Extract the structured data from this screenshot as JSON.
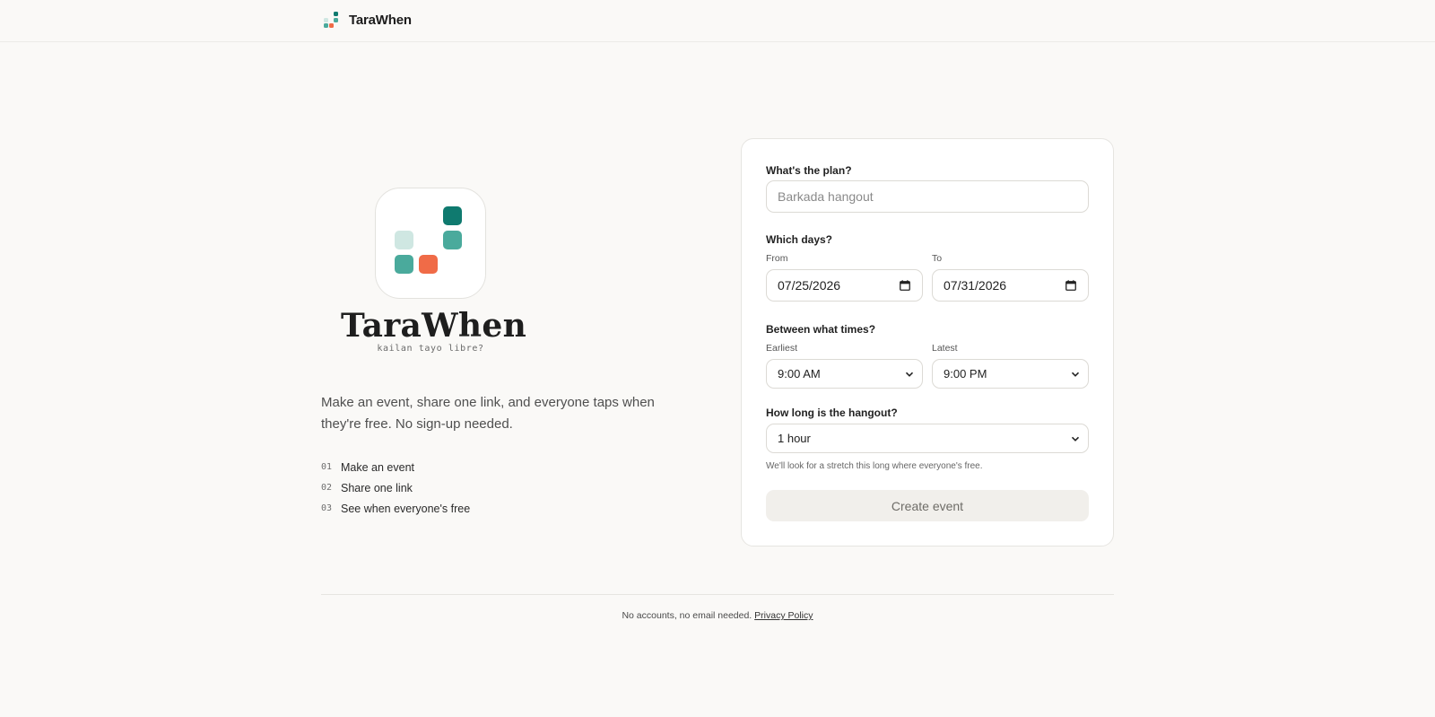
{
  "header": {
    "brand_name": "TaraWhen"
  },
  "hero": {
    "title": "TaraWhen",
    "tagline": "kailan tayo libre?",
    "description": "Make an event, share one link, and everyone taps when they're free. No sign-up needed.",
    "steps": [
      {
        "num": "01",
        "label": "Make an event"
      },
      {
        "num": "02",
        "label": "Share one link"
      },
      {
        "num": "03",
        "label": "See when everyone's free"
      }
    ]
  },
  "form": {
    "plan_label": "What's the plan?",
    "plan_placeholder": "Barkada hangout",
    "days_label": "Which days?",
    "from_label": "From",
    "from_value": "07/25/2026",
    "to_label": "To",
    "to_value": "07/31/2026",
    "times_label": "Between what times?",
    "earliest_label": "Earliest",
    "earliest_value": "9:00 AM",
    "latest_label": "Latest",
    "latest_value": "9:00 PM",
    "duration_label": "How long is the hangout?",
    "duration_value": "1 hour",
    "duration_hint": "We'll look for a stretch this long where everyone's free.",
    "create_button": "Create event"
  },
  "footer": {
    "text": "No accounts, no email needed.",
    "privacy_link": "Privacy Policy"
  },
  "colors": {
    "teal_dark": "#0f7a6f",
    "teal_mid": "#4aaa9c",
    "teal_light": "#cfe7e2",
    "coral": "#f06b47",
    "background": "#faf9f7"
  }
}
